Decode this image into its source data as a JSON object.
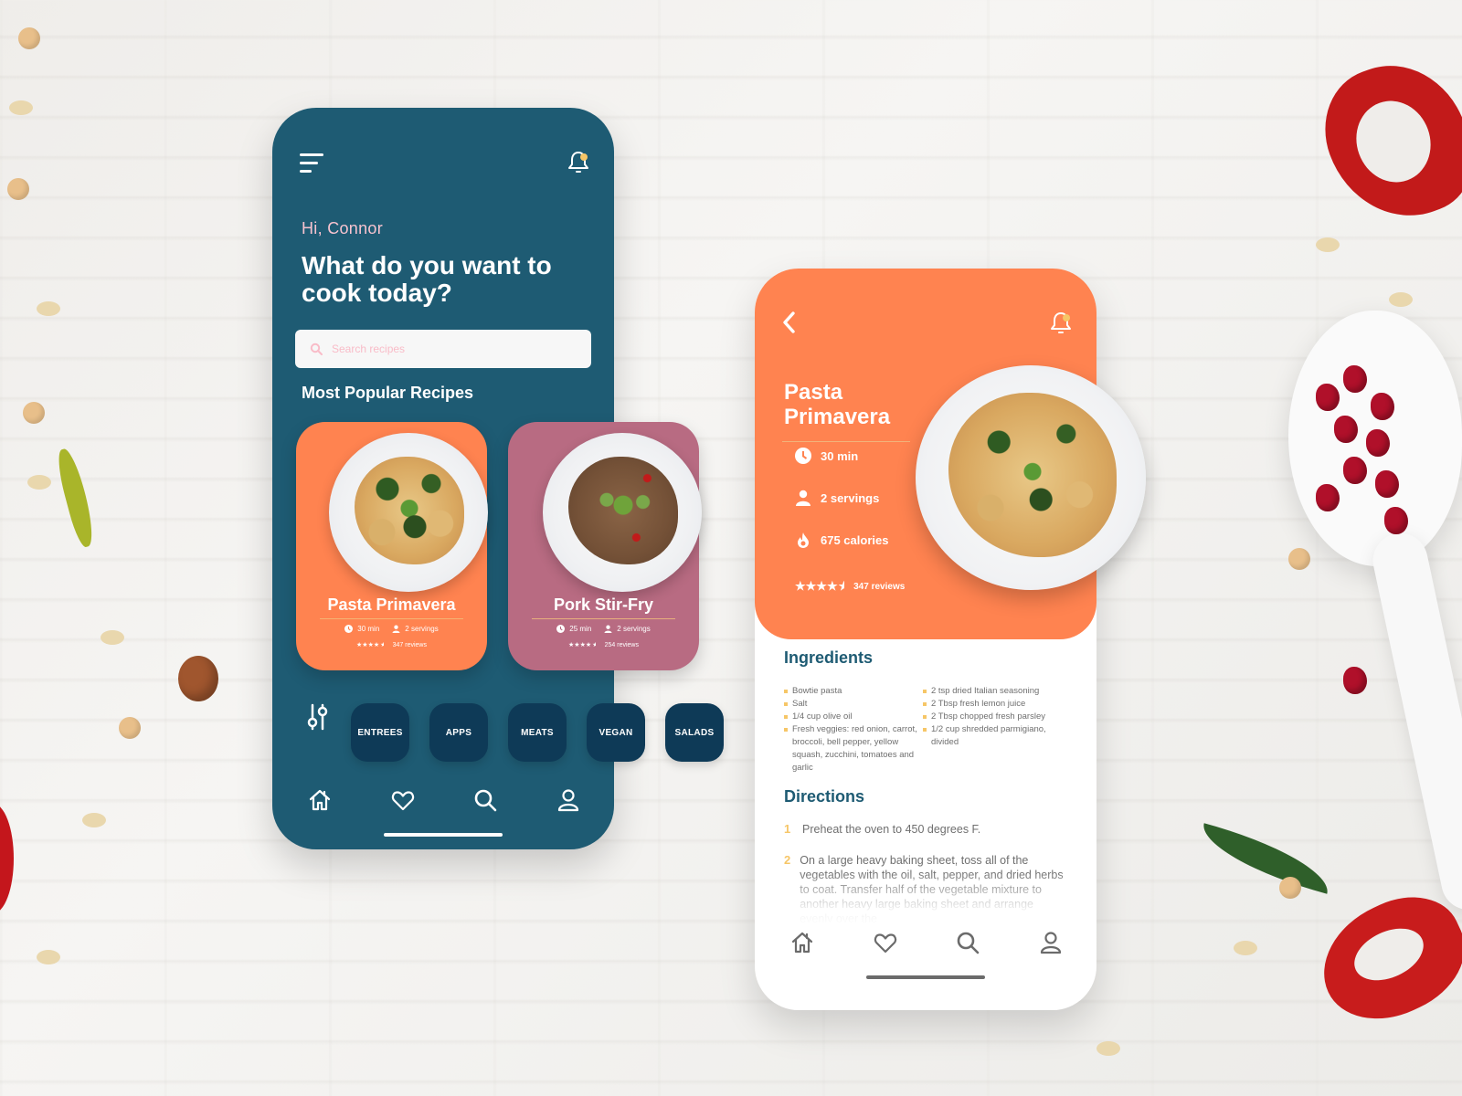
{
  "home_screen": {
    "greeting": "Hi, Connor",
    "headline": "What do you want to cook today?",
    "search": {
      "placeholder": "Search recipes",
      "value": ""
    },
    "section_title": "Most Popular Recipes",
    "recipes": [
      {
        "title": "Pasta Primavera",
        "time": "30 min",
        "servings": "2 servings",
        "rating": 4.5,
        "stars": "★★★★",
        "reviews": "347 reviews",
        "color": "#ff8350"
      },
      {
        "title": "Pork Stir-Fry",
        "time": "25 min",
        "servings": "2 servings",
        "rating": 4.5,
        "stars": "★★★★",
        "reviews": "254 reviews",
        "color": "#b86b82"
      }
    ],
    "categories": [
      "ENTREES",
      "APPS",
      "MEATS",
      "VEGAN",
      "SALADS"
    ],
    "nav": [
      "home",
      "favorites",
      "search",
      "profile"
    ],
    "active_nav": "search"
  },
  "detail_screen": {
    "title_line1": "Pasta",
    "title_line2": "Primavera",
    "time": "30 min",
    "servings": "2 servings",
    "calories": "675 calories",
    "rating": 4.5,
    "stars": "★★★★",
    "reviews": "347 reviews",
    "ingredients_heading": "Ingredients",
    "ingredients_left": [
      "Bowtie pasta",
      "Salt",
      "1/4 cup olive oil",
      "Fresh veggies: red onion, carrot, broccoli, bell pepper, yellow squash, zucchini, tomatoes and garlic"
    ],
    "ingredients_right": [
      "2 tsp dried Italian seasoning",
      "2 Tbsp fresh lemon juice",
      "2 Tbsp chopped fresh parsley",
      "1/2 cup shredded parmigiano, divided"
    ],
    "directions_heading": "Directions",
    "directions": [
      {
        "num": "1",
        "text": "Preheat the oven to 450 degrees F."
      },
      {
        "num": "2",
        "text": "On a large heavy baking sheet, toss all of the vegetables with the oil, salt, pepper, and dried herbs to coat. Transfer half of the vegetable mixture to another heavy large baking sheet and arrange evenly over the"
      }
    ],
    "nav": [
      "home",
      "favorites",
      "search",
      "profile"
    ]
  },
  "colors": {
    "teal": "#1e5b73",
    "navy": "#0e3a57",
    "orange": "#ff8350",
    "rose": "#b86b82",
    "yellow_accent": "#f6c667",
    "pink_text": "#f7c3cf"
  }
}
